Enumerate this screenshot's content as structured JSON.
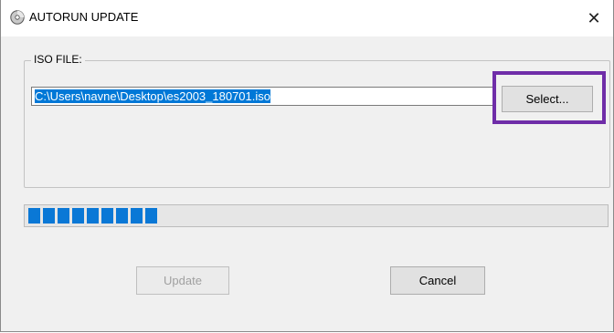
{
  "window": {
    "title": "AUTORUN UPDATE",
    "close_glyph": "✕"
  },
  "iso_group": {
    "label": "ISO FILE:",
    "path_value": "C:\\Users\\navne\\Desktop\\es2003_180701.iso",
    "select_label": "Select..."
  },
  "progress": {
    "fraction": 0.22,
    "segments": 9,
    "color": "#0a78d6"
  },
  "actions": {
    "update_label": "Update",
    "update_enabled": false,
    "cancel_label": "Cancel"
  },
  "icons": {
    "app": "cd-disc-icon",
    "close": "close-icon"
  },
  "colors": {
    "highlight": "#6f2da8",
    "selection": "#0078d7"
  }
}
